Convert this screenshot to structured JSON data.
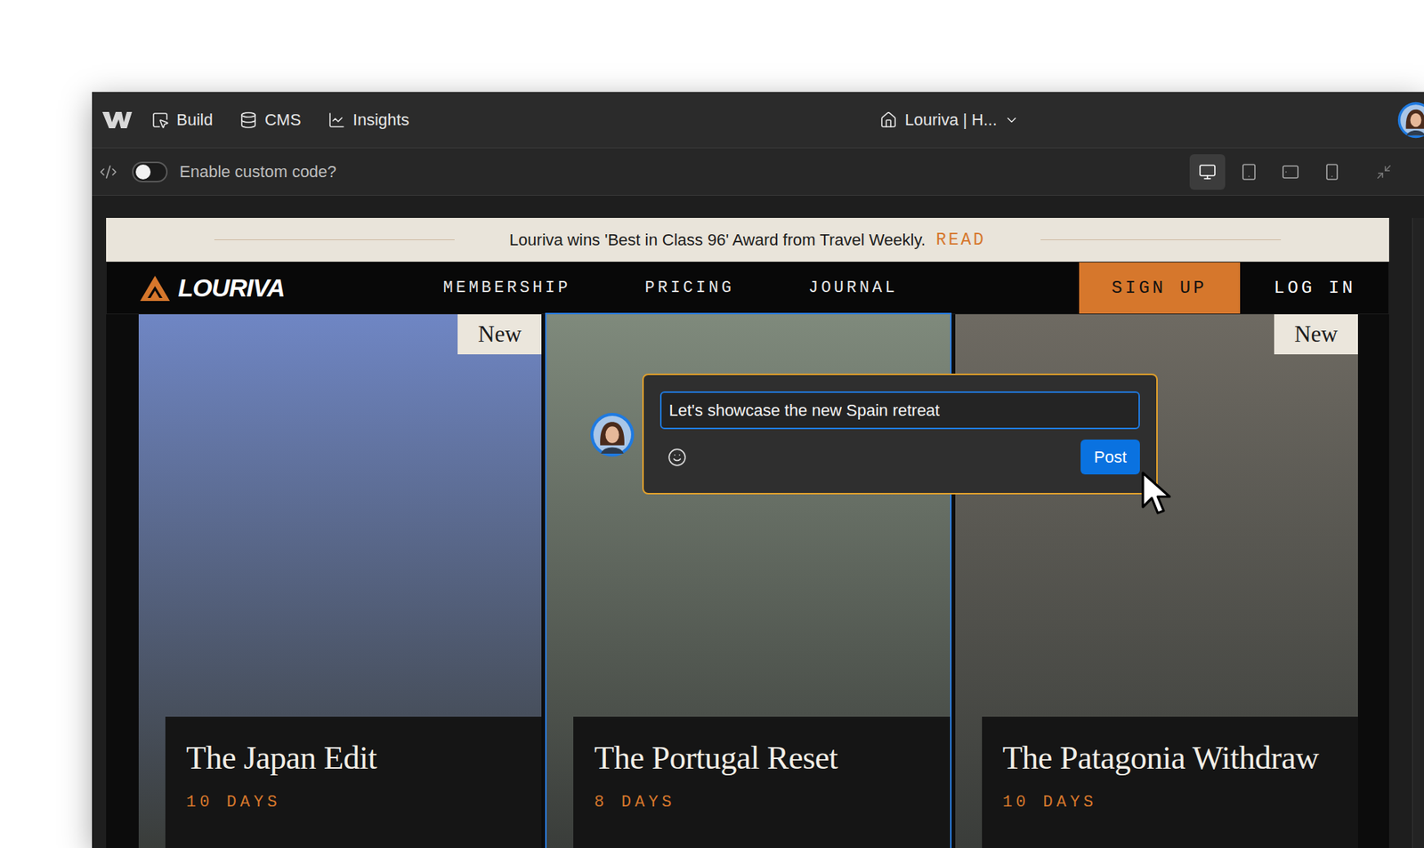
{
  "toolbar": {
    "tabs": [
      {
        "label": "Build",
        "kind": "build"
      },
      {
        "label": "CMS",
        "kind": "cms"
      },
      {
        "label": "Insights",
        "kind": "insights"
      }
    ],
    "page_selector": "Louriva | H..."
  },
  "code_bar": {
    "label": "Enable custom code?",
    "enabled": false,
    "breakpoints": [
      {
        "kind": "desktop",
        "selected": true
      },
      {
        "kind": "tablet",
        "selected": false
      },
      {
        "kind": "landscape",
        "selected": false
      },
      {
        "kind": "phone",
        "selected": false
      }
    ]
  },
  "site": {
    "announcement": {
      "text": "Louriva wins 'Best in Class 96' Award from Travel Weekly.",
      "link": "READ"
    },
    "nav": {
      "logo": "LOURIVA",
      "links": [
        "MEMBERSHIP",
        "PRICING",
        "JOURNAL"
      ],
      "sign_up": "SIGN UP",
      "log_in": "LOG IN"
    },
    "cards": [
      {
        "title": "The Japan Edit",
        "duration": "10 DAYS",
        "badge": "New",
        "selected": false,
        "color": "#6f86c4"
      },
      {
        "title": "The Portugal Reset",
        "duration": "8 DAYS",
        "badge": null,
        "selected": true,
        "color": "#7f8a7c"
      },
      {
        "title": "The Patagonia Withdraw",
        "duration": "10 DAYS",
        "badge": "New",
        "selected": false,
        "color": "#6e6a62"
      }
    ]
  },
  "comment": {
    "text": "Let's showcase the new Spain retreat",
    "button": "Post"
  }
}
